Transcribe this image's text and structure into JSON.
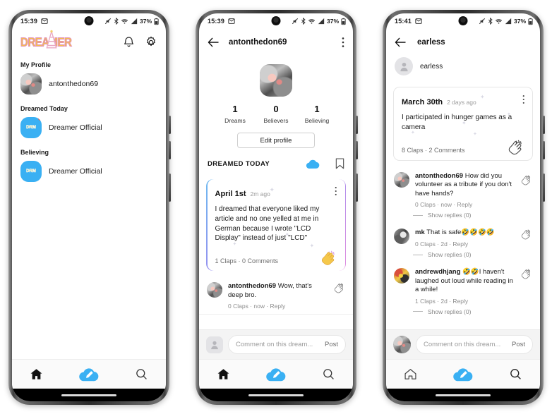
{
  "app": {
    "name": "Dreamer",
    "logo_text": "DREAMER",
    "accent": "#3ab0f3",
    "gradient": "#6fb9f0 → #e08de0"
  },
  "phones": [
    {
      "id": "phone-home",
      "status": {
        "time": "15:39",
        "battery": "37%",
        "icons": [
          "mute-icon",
          "bluetooth-icon",
          "wifi-icon",
          "signal-icon",
          "battery-icon"
        ]
      },
      "header": {
        "kind": "logo",
        "logo": "DREAMER",
        "bell": "bell-icon",
        "gear": "gear-icon"
      },
      "sections": [
        {
          "label": "My Profile",
          "items": [
            {
              "name": "antonthedon69",
              "avatar": "photo-a",
              "badge": false
            }
          ]
        },
        {
          "label": "Dreamed Today",
          "items": [
            {
              "name": "Dreamer Official",
              "avatar": "official",
              "badge": true
            }
          ]
        },
        {
          "label": "Believing",
          "items": [
            {
              "name": "Dreamer Official",
              "avatar": "official",
              "badge": false
            }
          ]
        }
      ],
      "nav": {
        "home": "home-icon",
        "home_active": true,
        "compose": "cloud-pencil-icon",
        "search": "search-icon",
        "active": "compose"
      }
    },
    {
      "id": "phone-profile",
      "status": {
        "time": "15:39",
        "battery": "37%"
      },
      "header": {
        "kind": "title",
        "back": "back-arrow-icon",
        "title": "antonthedon69",
        "menu": "more-vertical-icon"
      },
      "profile": {
        "avatar": "photo-a",
        "stats": [
          {
            "num": "1",
            "label": "Dreams"
          },
          {
            "num": "0",
            "label": "Believers"
          },
          {
            "num": "1",
            "label": "Believing"
          }
        ],
        "edit_label": "Edit profile"
      },
      "feed_bar": {
        "title": "DREAMED TODAY",
        "cloud": "cloud-icon",
        "bookmark": "bookmark-icon"
      },
      "dream": {
        "date": "April 1st",
        "ago": "2m ago",
        "text": "I dreamed that everyone liked my article and no one yelled at me in German because I wrote \"LCD Display\" instead of just \"LCD\"",
        "meta": "1 Claps · 0 Comments",
        "clap": "clap-icon-filled",
        "menu": "more-vertical-icon",
        "highlighted": true
      },
      "comments": [
        {
          "author": "antonthedon69",
          "text": "Wow, that's deep bro.",
          "meta": "0 Claps  ·  now  ·  Reply",
          "avatar": "photo-a",
          "clap": "clap-icon",
          "show_replies": null
        }
      ],
      "comment_box": {
        "placeholder": "Comment on this dream...",
        "post_label": "Post",
        "avatar": "gray-person"
      },
      "nav": {
        "home": "home-icon",
        "compose": "cloud-pencil-icon",
        "search": "search-icon",
        "active": "compose"
      }
    },
    {
      "id": "phone-dream-detail",
      "status": {
        "time": "15:41",
        "battery": "37%"
      },
      "header": {
        "kind": "title",
        "back": "back-arrow-icon",
        "title": "earless",
        "menu": null
      },
      "author_row": {
        "name": "earless",
        "avatar": "gray-person"
      },
      "dream": {
        "date": "March 30th",
        "ago": "2 days ago",
        "text": "I participated in hunger games as a camera",
        "meta": "8 Claps · 2 Comments",
        "clap": "clap-icon",
        "menu": "more-vertical-icon",
        "highlighted": false
      },
      "comments": [
        {
          "author": "antonthedon69",
          "text": "How did you volunteer as a tribute if you don't have hands?",
          "meta": "0 Claps  ·  now  ·  Reply",
          "avatar": "photo-a",
          "clap": "clap-icon",
          "show_replies": "Show replies (0)"
        },
        {
          "author": "mk",
          "text": "That is safe🤣🤣🤣🤣",
          "meta": "0 Claps  ·  2d  ·  Reply",
          "avatar": "photo-b",
          "clap": "clap-icon",
          "show_replies": "Show replies (0)"
        },
        {
          "author": "andrewdhjang",
          "text": "🤣🤣I haven't laughed out loud while reading in a while!",
          "meta": "1 Claps  ·  2d  ·  Reply",
          "avatar": "photo-c",
          "clap": "clap-icon",
          "show_replies": "Show replies (0)"
        }
      ],
      "comment_box": {
        "placeholder": "Comment on this dream...",
        "post_label": "Post",
        "avatar": "photo-a"
      },
      "nav": {
        "home": "home-icon",
        "compose": "cloud-pencil-icon",
        "search": "search-icon",
        "active": "compose"
      }
    }
  ]
}
